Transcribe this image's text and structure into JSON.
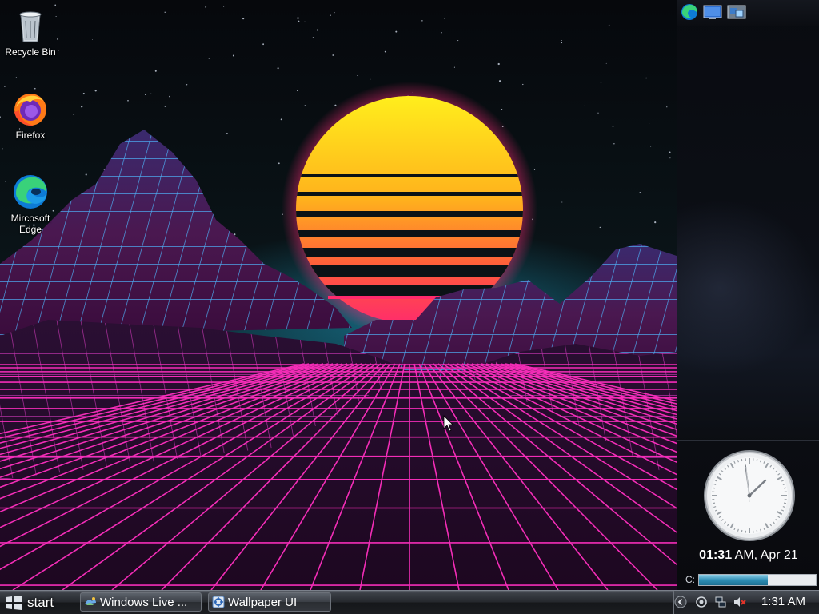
{
  "desktop": {
    "icons": [
      {
        "label": "Recycle Bin",
        "icon": "recycle-bin-icon"
      },
      {
        "label": "Firefox",
        "icon": "firefox-icon"
      },
      {
        "label": "Mircosoft Edge",
        "icon": "edge-icon"
      }
    ]
  },
  "sidebar": {
    "toolbar": [
      "edge-icon",
      "desktop-icon",
      "gadgets-icon"
    ],
    "clock": {
      "time": "01:31",
      "suffix": " AM, Apr 21"
    },
    "drive": {
      "label": "C:",
      "used_fraction": 0.59
    }
  },
  "taskbar": {
    "start_label": "start",
    "tasks": [
      {
        "label": "Windows Live ...",
        "icon": "windows-live-icon"
      },
      {
        "label": "Wallpaper UI",
        "icon": "wallpaper-ui-icon"
      }
    ],
    "tray": {
      "icons": [
        "show-hidden-icon",
        "network-sync-icon",
        "network-icon",
        "volume-muted-icon"
      ],
      "time": "1:31 AM"
    }
  },
  "colors": {
    "sun_top": "#ffef1c",
    "sun_bottom": "#ff2a6d",
    "grid_pink": "#ff2fbf",
    "grid_cyan": "#39c8ff"
  }
}
